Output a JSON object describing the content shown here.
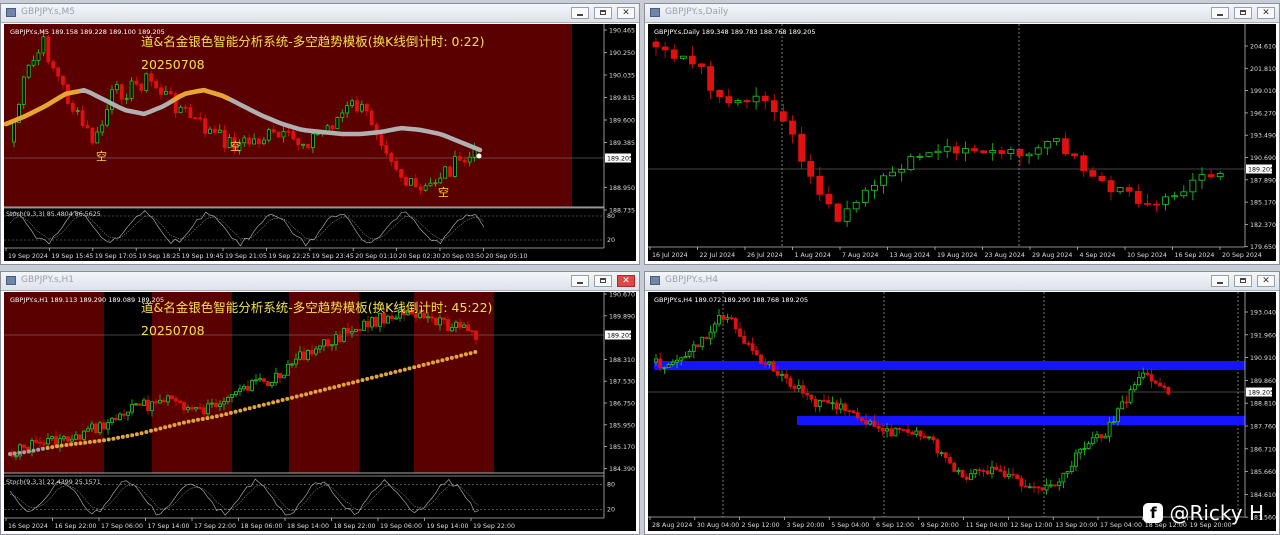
{
  "windows": [
    {
      "id": "m5",
      "title": "GBPJPY.s,M5",
      "header": "GBPJPY.s,M5  189.158 189.228 189.100 189.205",
      "overlay": {
        "line1": "道&名金银色智能分析系统-多空趋势模板(换K线倒计时: 0:22)",
        "line2": "20250708"
      },
      "price_ticks": [
        "190.465",
        "190.250",
        "190.035",
        "189.815",
        "189.600",
        "189.385",
        "189.205",
        "188.950",
        "188.735"
      ],
      "current_price": "189.205",
      "time_ticks": [
        "19 Sep 2024",
        "19 Sep 15:45",
        "19 Sep 17:05",
        "19 Sep 18:25",
        "19 Sep 19:45",
        "19 Sep 21:05",
        "19 Sep 22:25",
        "19 Sep 23:45",
        "20 Sep 01:10",
        "20 Sep 02:30",
        "20 Sep 03:50",
        "20 Sep 05:10"
      ],
      "stoch": {
        "label": "Stoch(9,3,3) 85.4804 86.5625",
        "levels": [
          "80",
          "20"
        ],
        "top": "100",
        "bottom": "0"
      },
      "marks": [
        "空",
        "空",
        "空"
      ]
    },
    {
      "id": "daily",
      "title": "GBPJPY.s,Daily",
      "header": "GBPJPY.s,Daily  189.348 189.783 188.768 189.205",
      "price_ticks": [
        "204.610",
        "201.810",
        "199.010",
        "196.270",
        "193.490",
        "190.690",
        "187.890",
        "185.170",
        "182.370",
        "179.650"
      ],
      "current_price": "189.205",
      "time_ticks": [
        "16 Jul 2024",
        "22 Jul 2024",
        "26 Jul 2024",
        "1 Aug 2024",
        "7 Aug 2024",
        "13 Aug 2024",
        "19 Aug 2024",
        "23 Aug 2024",
        "29 Aug 2024",
        "4 Sep 2024",
        "10 Sep 2024",
        "16 Sep 2024",
        "20 Sep 2024"
      ]
    },
    {
      "id": "h1",
      "title": "GBPJPY.s,H1",
      "header": "GBPJPY.s,H1  189.113 189.290 189.089 189.205",
      "overlay": {
        "line1": "道&名金银色智能分析系统-多空趋势模板(换K线倒计时: 45:22)",
        "line2": "20250708"
      },
      "price_ticks": [
        "190.670",
        "189.890",
        "189.205",
        "188.310",
        "187.530",
        "186.750",
        "185.950",
        "185.170",
        "184.390"
      ],
      "current_price": "189.205",
      "time_ticks": [
        "16 Sep 2024",
        "16 Sep 22:00",
        "17 Sep 06:00",
        "17 Sep 14:00",
        "17 Sep 22:00",
        "18 Sep 06:00",
        "18 Sep 14:00",
        "18 Sep 22:00",
        "19 Sep 06:00",
        "19 Sep 14:00",
        "19 Sep 22:00"
      ],
      "stoch": {
        "label": "Stoch(9,3,3) 22.4399 25.1571",
        "levels": [
          "80",
          "20"
        ],
        "top": "100",
        "bottom": "0"
      }
    },
    {
      "id": "h4",
      "title": "GBPJPY.s,H4",
      "header": "GBPJPY.s,H4  189.072 189.290 188.768 189.205",
      "price_ticks": [
        "193.040",
        "191.960",
        "190.910",
        "189.860",
        "188.810",
        "187.760",
        "186.710",
        "185.660",
        "184.610",
        "183.560"
      ],
      "current_price": "189.205",
      "time_ticks": [
        "28 Aug 2024",
        "30 Aug 04:00",
        "2 Sep 12:00",
        "3 Sep 20:00",
        "5 Sep 04:00",
        "6 Sep 12:00",
        "9 Sep 20:00",
        "11 Sep 04:00",
        "12 Sep 12:00",
        "13 Sep 20:00",
        "17 Sep 04:00",
        "18 Sep 12:00",
        "19 Sep 20:00"
      ]
    }
  ],
  "watermark": {
    "icon": "facebook-icon",
    "text": "@Ricky H"
  },
  "colors": {
    "bull": "#22cc22",
    "bear": "#e01010",
    "session_red": "#5a0000",
    "zone_blue": "#1414ff",
    "ma_gold": "#e8a630",
    "ma_silver": "#b0b0b0"
  }
}
